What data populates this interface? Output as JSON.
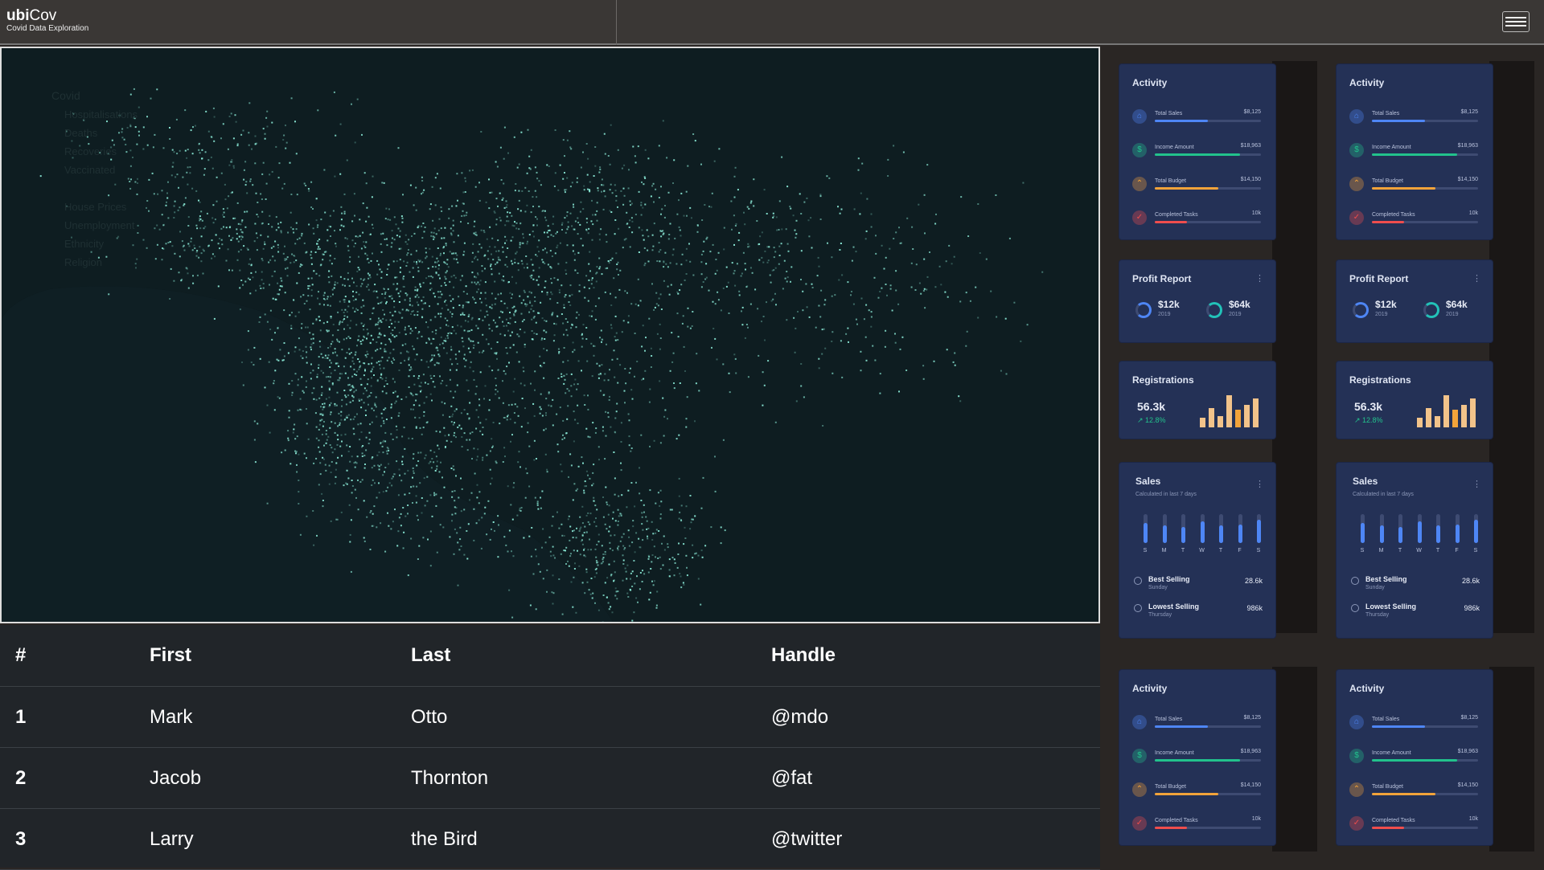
{
  "header": {
    "brand_bold": "ubi",
    "brand_rest": "Cov",
    "tagline": "Covid Data Exploration"
  },
  "map": {
    "layers": {
      "group": "Covid",
      "items": [
        "Hospitalisations",
        "Deaths",
        "Recoveries",
        "Vaccinated",
        "",
        "House Prices",
        "Unemployment",
        "Ethnicity",
        "Religion"
      ]
    }
  },
  "table": {
    "headers": [
      "#",
      "First",
      "Last",
      "Handle"
    ],
    "rows": [
      [
        "1",
        "Mark",
        "Otto",
        "@mdo"
      ],
      [
        "2",
        "Jacob",
        "Thornton",
        "@fat"
      ],
      [
        "3",
        "Larry",
        "the Bird",
        "@twitter"
      ]
    ]
  },
  "dashboard": {
    "activity": {
      "title": "Activity",
      "items": [
        {
          "label": "Total Sales",
          "value": "$8,125",
          "progress": 0.5,
          "color": "#4e86f5",
          "icon": "home-icon"
        },
        {
          "label": "Income Amount",
          "value": "$18,963",
          "progress": 0.8,
          "color": "#22c28c",
          "icon": "dollar-icon"
        },
        {
          "label": "Total Budget",
          "value": "$14,150",
          "progress": 0.6,
          "color": "#f2a33a",
          "icon": "trend-icon"
        },
        {
          "label": "Completed Tasks",
          "value": "10k",
          "progress": 0.3,
          "color": "#ef4d4d",
          "icon": "check-icon"
        }
      ]
    },
    "profit": {
      "title": "Profit Report",
      "items": [
        {
          "amount": "$12k",
          "year": "2019",
          "color": "#4e86f5"
        },
        {
          "amount": "$64k",
          "year": "2019",
          "color": "#22c2b8"
        }
      ]
    },
    "registrations": {
      "title": "Registrations",
      "value": "56.3k",
      "change": "↗ 12.8%",
      "bars": [
        0.3,
        0.6,
        0.35,
        1.0,
        0.55,
        0.7,
        0.9
      ],
      "bar_colors": [
        "#f2c38a",
        "#f2c38a",
        "#f2c38a",
        "#f2c38a",
        "#f2a33a",
        "#f2c38a",
        "#f2c38a"
      ]
    },
    "sales": {
      "title": "Sales",
      "subtitle": "Calculated in last 7 days",
      "days": [
        "S",
        "M",
        "T",
        "W",
        "T",
        "F",
        "S"
      ],
      "levels": [
        0.7,
        0.6,
        0.55,
        0.75,
        0.6,
        0.65,
        0.8
      ],
      "best": {
        "label": "Best Selling",
        "sub": "Sunday",
        "value": "28.6k"
      },
      "lowest": {
        "label": "Lowest Selling",
        "sub": "Thursday",
        "value": "986k"
      }
    }
  },
  "colors": {
    "map_bg": "#0a1619",
    "point": "#8ef0dc",
    "card_bg": "#243156",
    "table_bg": "#212529"
  }
}
